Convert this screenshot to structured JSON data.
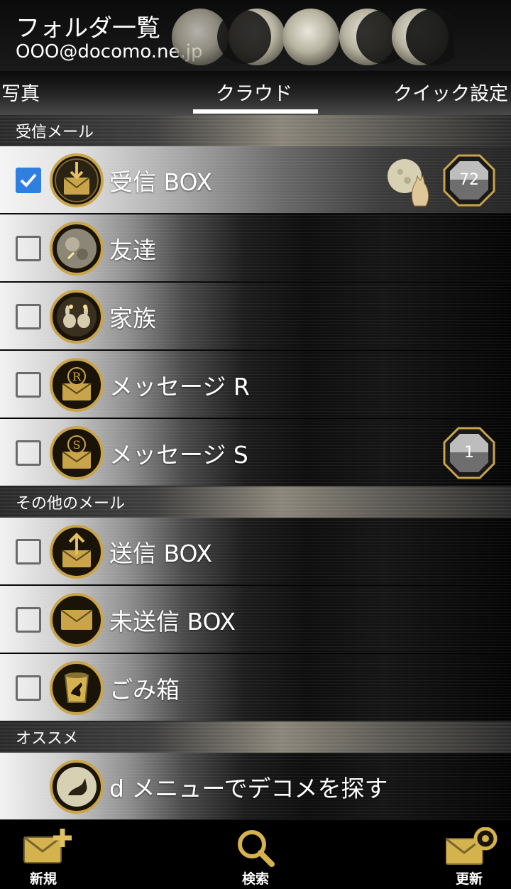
{
  "header": {
    "title": "フォルダ一覧",
    "email": "OOO@docomo.ne.jp"
  },
  "tabs": {
    "photos": "写真",
    "cloud": "クラウド",
    "quick_settings": "クイック設定",
    "active": "cloud"
  },
  "sections": {
    "inbox": "受信メール",
    "other": "その他のメール",
    "recommend": "オススメ"
  },
  "folders": [
    {
      "label": "受信 BOX",
      "checked": true,
      "badge": "72",
      "icon": "inbox-envelope-icon"
    },
    {
      "label": "友達",
      "checked": false,
      "badge": "",
      "icon": "friends-moon-icon"
    },
    {
      "label": "家族",
      "checked": false,
      "badge": "",
      "icon": "family-rabbits-icon"
    },
    {
      "label": "メッセージ R",
      "checked": false,
      "badge": "",
      "icon": "message-r-icon"
    },
    {
      "label": "メッセージ S",
      "checked": false,
      "badge": "1",
      "icon": "message-s-icon"
    }
  ],
  "other_folders": [
    {
      "label": "送信 BOX",
      "checked": false,
      "icon": "outbox-envelope-icon"
    },
    {
      "label": "未送信 BOX",
      "checked": false,
      "icon": "draft-envelope-icon"
    },
    {
      "label": "ごみ箱",
      "checked": false,
      "icon": "trash-icon"
    }
  ],
  "recommend": {
    "label": "d メニューでデコメを探す",
    "icon": "rabbit-moon-icon"
  },
  "bottom": {
    "new": "新規",
    "search": "検索",
    "update": "更新"
  },
  "colors": {
    "gold": "#c9a44a",
    "check_blue": "#2f7fe0"
  }
}
